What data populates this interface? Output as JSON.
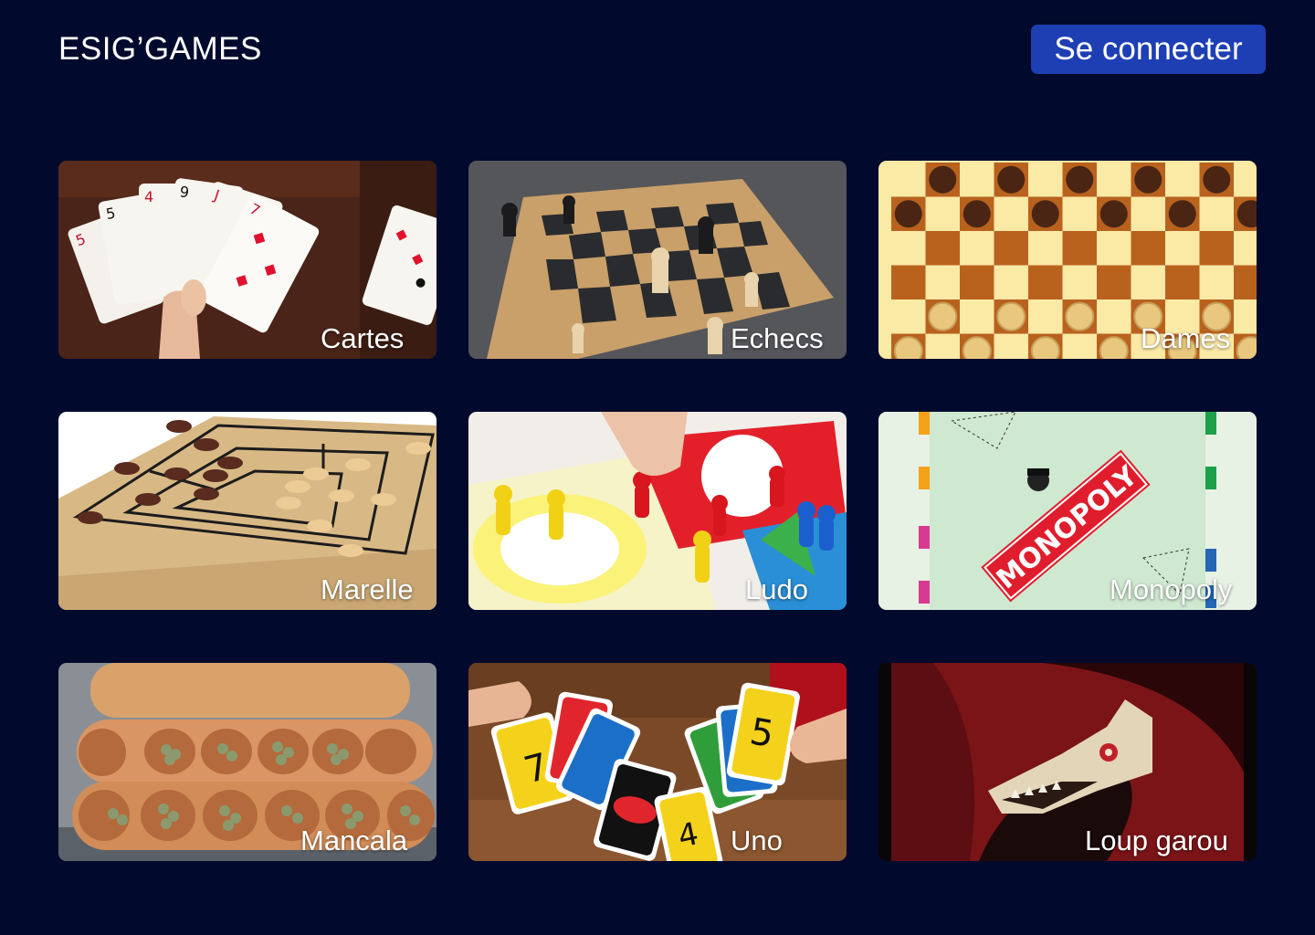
{
  "header": {
    "brand": "ESIG’GAMES",
    "login_label": "Se connecter"
  },
  "colors": {
    "background": "#010a2d",
    "button": "#1e3fb3"
  },
  "games": [
    {
      "label": "Cartes",
      "image": "playing-cards-photo"
    },
    {
      "label": "Echecs",
      "image": "chess-board-photo"
    },
    {
      "label": "Dames",
      "image": "checkers-board-photo"
    },
    {
      "label": "Marelle",
      "image": "nine-mens-morris-board-photo"
    },
    {
      "label": "Ludo",
      "image": "ludo-board-photo"
    },
    {
      "label": "Monopoly",
      "image": "monopoly-board-photo"
    },
    {
      "label": "Mancala",
      "image": "mancala-board-photo"
    },
    {
      "label": "Uno",
      "image": "uno-cards-photo"
    },
    {
      "label": "Loup garou",
      "image": "werewolf-illustration"
    }
  ]
}
